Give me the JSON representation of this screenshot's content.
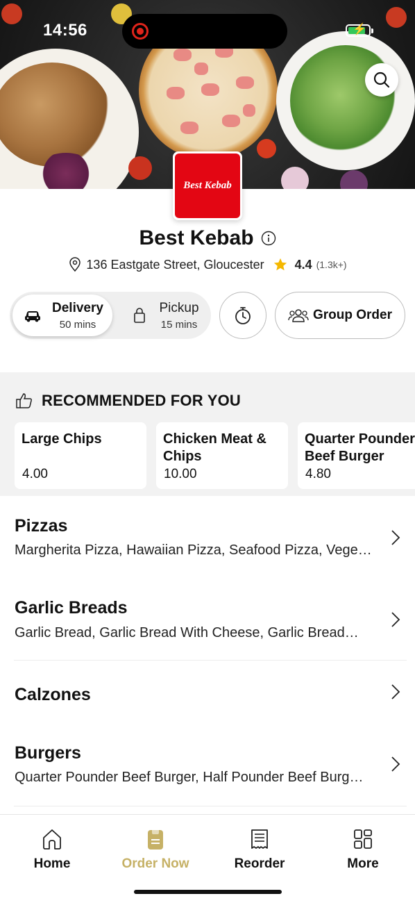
{
  "status_bar": {
    "time": "14:56"
  },
  "restaurant": {
    "logo_text": "Best Kebab",
    "name": "Best Kebab",
    "address": "136 Eastgate Street, Gloucester",
    "rating": "4.4",
    "rating_count": "(1.3k+)"
  },
  "order_modes": {
    "delivery": {
      "label": "Delivery",
      "time": "50 mins",
      "selected": true
    },
    "pickup": {
      "label": "Pickup",
      "time": "15 mins",
      "selected": false
    }
  },
  "group_order_label": "Group Order",
  "recommended": {
    "title": "RECOMMENDED FOR YOU",
    "items": [
      {
        "name_line1": "Large Chips",
        "name_line2": "",
        "price": "4.00"
      },
      {
        "name_line1": "Chicken Meat &",
        "name_line2": "Chips",
        "price": "10.00"
      },
      {
        "name_line1": "Quarter Pounder",
        "name_line2": "Beef Burger",
        "price": "4.80"
      }
    ]
  },
  "categories": [
    {
      "title": "Pizzas",
      "items": "Margherita Pizza, Hawaiian Pizza, Seafood Pizza, Vege…"
    },
    {
      "title": "Garlic Breads",
      "items": "Garlic Bread, Garlic Bread With Cheese, Garlic Bread…"
    },
    {
      "title": "Calzones",
      "items": ""
    },
    {
      "title": "Burgers",
      "items": "Quarter Pounder Beef Burger, Half Pounder Beef Burg…"
    }
  ],
  "tab_bar": {
    "active": "Order Now",
    "accent_color": "#c6b166",
    "tabs": [
      {
        "label": "Home",
        "icon": "home-icon"
      },
      {
        "label": "Order Now",
        "icon": "order-bag-icon"
      },
      {
        "label": "Reorder",
        "icon": "receipt-icon"
      },
      {
        "label": "More",
        "icon": "grid-icon"
      }
    ]
  },
  "colors": {
    "brand_red": "#e30613",
    "star": "#f5b800",
    "accent_gold": "#c6b166"
  }
}
